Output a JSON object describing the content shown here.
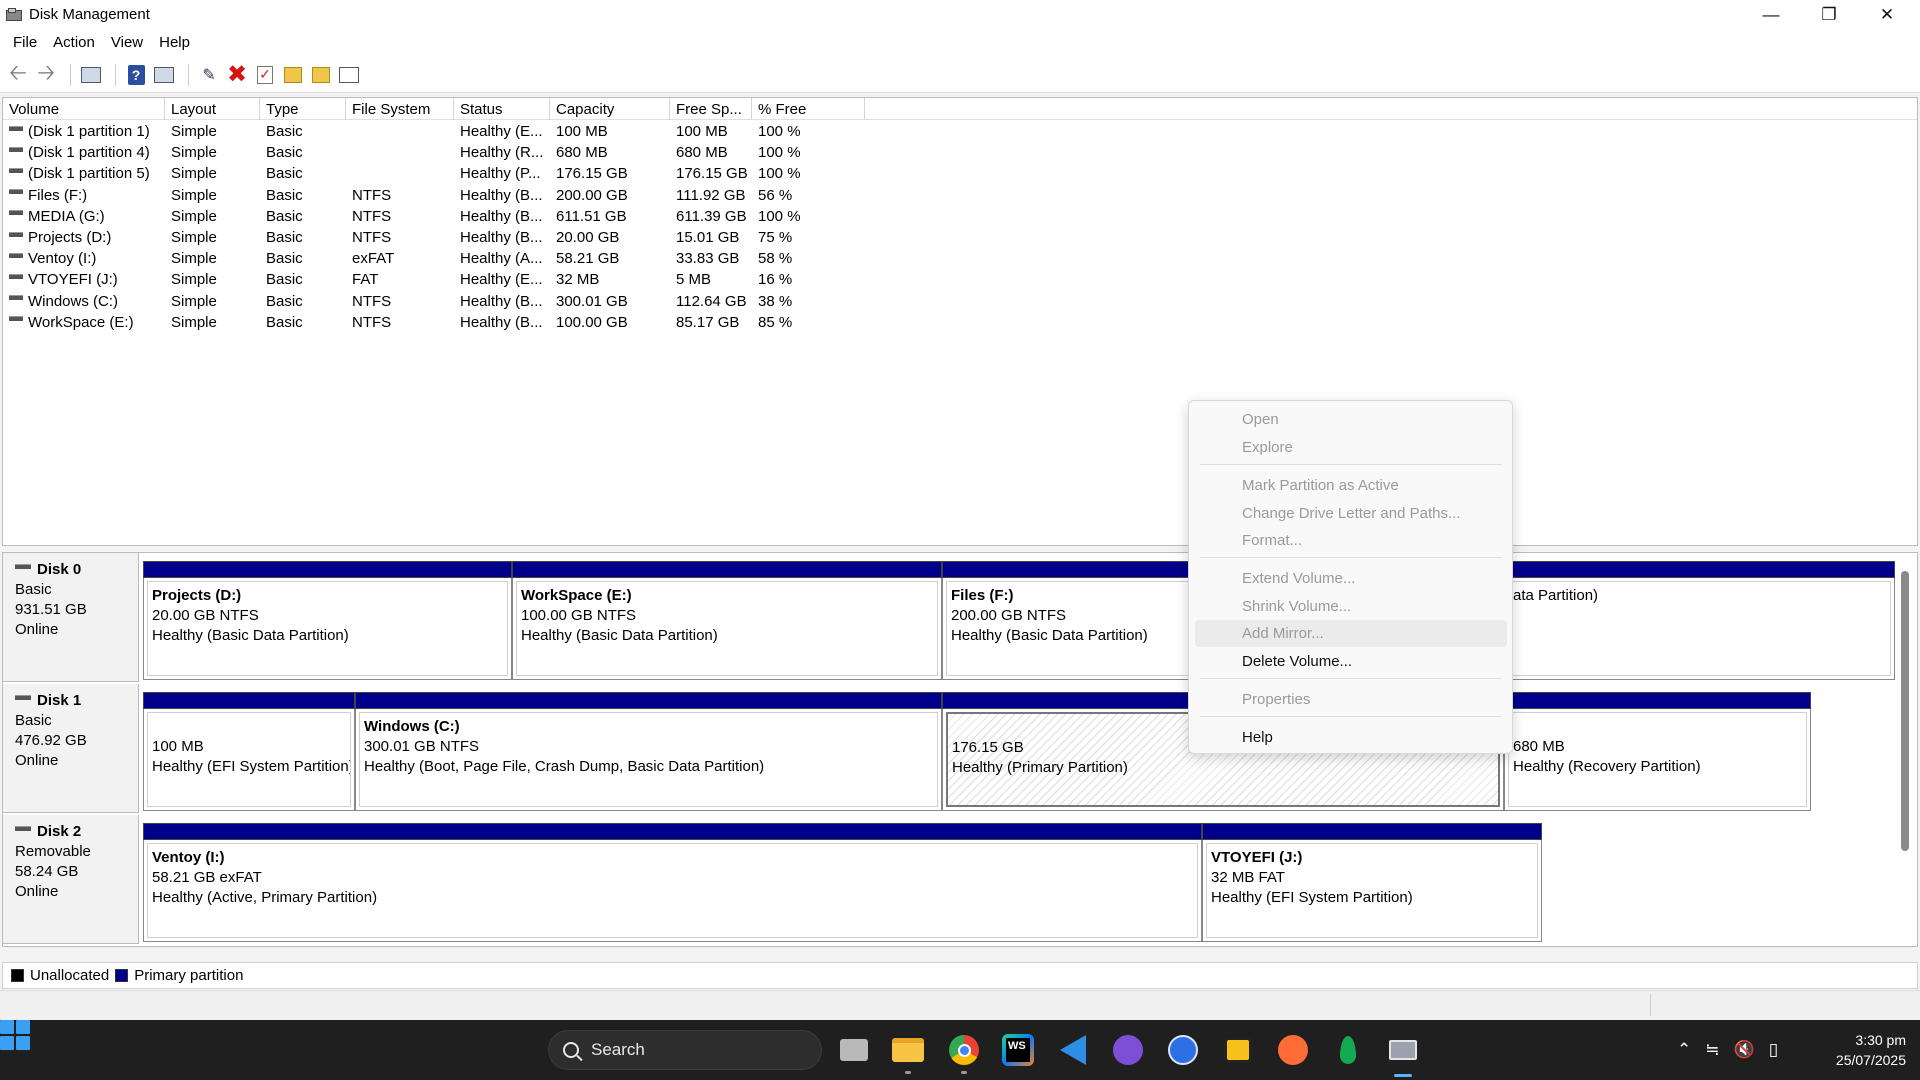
{
  "window": {
    "title": "Disk Management",
    "minimize_icon": "minimize-icon",
    "maximize_icon": "restore-icon",
    "close_icon": "close-icon"
  },
  "menu": [
    "File",
    "Action",
    "View",
    "Help"
  ],
  "toolbar": [
    "back-icon",
    "forward-icon",
    "console-tree-icon",
    "help-icon",
    "properties-icon",
    "connect-icon",
    "delete-icon",
    "check-icon",
    "up-folder-icon",
    "search-folder-icon",
    "list-view-icon"
  ],
  "volume_table": {
    "columns": [
      "Volume",
      "Layout",
      "Type",
      "File System",
      "Status",
      "Capacity",
      "Free Sp...",
      "% Free"
    ],
    "rows": [
      [
        "(Disk 1 partition 1)",
        "Simple",
        "Basic",
        "",
        "Healthy (E...",
        "100 MB",
        "100 MB",
        "100 %"
      ],
      [
        "(Disk 1 partition 4)",
        "Simple",
        "Basic",
        "",
        "Healthy (R...",
        "680 MB",
        "680 MB",
        "100 %"
      ],
      [
        "(Disk 1 partition 5)",
        "Simple",
        "Basic",
        "",
        "Healthy (P...",
        "176.15 GB",
        "176.15 GB",
        "100 %"
      ],
      [
        "Files (F:)",
        "Simple",
        "Basic",
        "NTFS",
        "Healthy (B...",
        "200.00 GB",
        "111.92 GB",
        "56 %"
      ],
      [
        "MEDIA (G:)",
        "Simple",
        "Basic",
        "NTFS",
        "Healthy (B...",
        "611.51 GB",
        "611.39 GB",
        "100 %"
      ],
      [
        "Projects (D:)",
        "Simple",
        "Basic",
        "NTFS",
        "Healthy (B...",
        "20.00 GB",
        "15.01 GB",
        "75 %"
      ],
      [
        "Ventoy (I:)",
        "Simple",
        "Basic",
        "exFAT",
        "Healthy (A...",
        "58.21 GB",
        "33.83 GB",
        "58 %"
      ],
      [
        "VTOYEFI (J:)",
        "Simple",
        "Basic",
        "FAT",
        "Healthy (E...",
        "32 MB",
        "5 MB",
        "16 %"
      ],
      [
        "Windows (C:)",
        "Simple",
        "Basic",
        "NTFS",
        "Healthy (B...",
        "300.01 GB",
        "112.64 GB",
        "38 %"
      ],
      [
        "WorkSpace (E:)",
        "Simple",
        "Basic",
        "NTFS",
        "Healthy (B...",
        "100.00 GB",
        "85.17 GB",
        "85 %"
      ]
    ]
  },
  "disks": [
    {
      "name": "Disk 0",
      "kind": "Basic",
      "size": "931.51 GB",
      "state": "Online",
      "partitions": [
        {
          "name": "Projects  (D:)",
          "size": "20.00 GB NTFS",
          "status": "Healthy (Basic Data Partition)"
        },
        {
          "name": "WorkSpace  (E:)",
          "size": "100.00 GB NTFS",
          "status": "Healthy (Basic Data Partition)"
        },
        {
          "name": "Files  (F:)",
          "size": "200.00 GB NTFS",
          "status": "Healthy (Basic Data Partition)"
        },
        {
          "name": "",
          "size": "",
          "status": "ata Partition)"
        }
      ]
    },
    {
      "name": "Disk 1",
      "kind": "Basic",
      "size": "476.92 GB",
      "state": "Online",
      "partitions": [
        {
          "name": "",
          "size": "100 MB",
          "status": "Healthy (EFI System Partition)"
        },
        {
          "name": "Windows  (C:)",
          "size": "300.01 GB NTFS",
          "status": "Healthy (Boot, Page File, Crash Dump, Basic Data Partition)"
        },
        {
          "name": "",
          "size": "176.15 GB",
          "status": "Healthy (Primary Partition)"
        },
        {
          "name": "",
          "size": "680 MB",
          "status": "Healthy (Recovery Partition)"
        }
      ]
    },
    {
      "name": "Disk 2",
      "kind": "Removable",
      "size": "58.24 GB",
      "state": "Online",
      "partitions": [
        {
          "name": "Ventoy  (I:)",
          "size": "58.21 GB exFAT",
          "status": "Healthy (Active, Primary Partition)"
        },
        {
          "name": "VTOYEFI  (J:)",
          "size": "32 MB FAT",
          "status": "Healthy (EFI System Partition)"
        }
      ]
    }
  ],
  "legend": {
    "unallocated": "Unallocated",
    "primary": "Primary partition",
    "unallocated_color": "#000000",
    "primary_color": "#00008b"
  },
  "context_menu": {
    "open": "Open",
    "explore": "Explore",
    "mark_active": "Mark Partition as Active",
    "change_letter": "Change Drive Letter and Paths...",
    "format": "Format...",
    "extend": "Extend Volume...",
    "shrink": "Shrink Volume...",
    "add_mirror": "Add Mirror...",
    "delete": "Delete Volume...",
    "properties": "Properties",
    "help": "Help"
  },
  "taskbar": {
    "search_placeholder": "Search",
    "apps": [
      "task-view-icon",
      "file-explorer-icon",
      "chrome-icon",
      "webstorm-icon",
      "vscode-icon",
      "github-desktop-icon",
      "app-store-icon",
      "notes-icon",
      "postman-icon",
      "mongodb-icon",
      "disk-management-icon"
    ],
    "webstorm_label": "WS",
    "time": "3:30 pm",
    "date": "25/07/2025"
  }
}
